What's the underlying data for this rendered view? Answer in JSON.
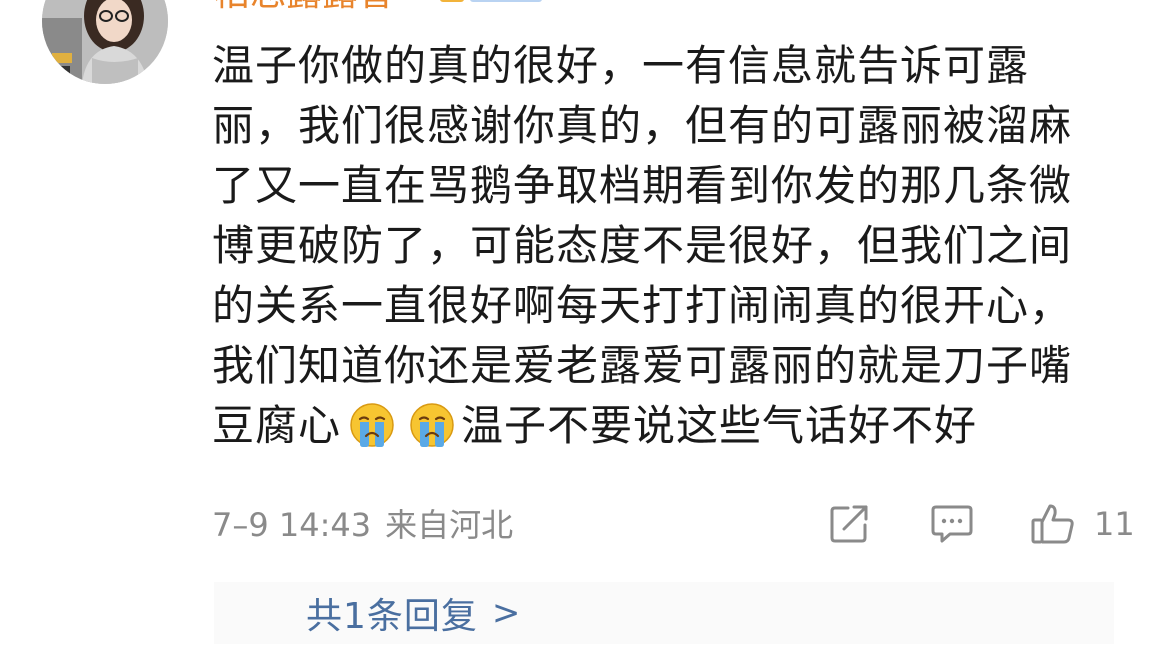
{
  "comment": {
    "author": "柏忘露露香",
    "lines": [
      "温子你做的真的很好，一有信息就告诉可露",
      "丽，我们很感谢你真的，但有的可露丽被溜麻",
      "了又一直在骂鹅争取档期看到你发的那几条微",
      "博更破防了，可能态度不是很好，但我们之间",
      "的关系一直很好啊每天打打闹闹真的很开心，",
      "我们知道你还是爱老露爱可露丽的就是刀子嘴"
    ],
    "last_line_prefix": "豆腐心",
    "last_line_suffix": "温子不要说这些气话好不好",
    "emoji_name": "crying-face-icon",
    "date": "7–9 14:43",
    "location": "来自河北",
    "like_count": "11"
  },
  "replies": {
    "label": "共1条回复",
    "chevron": ">"
  },
  "colors": {
    "text": "#1a1a1a",
    "meta": "#8a8a8a",
    "link": "#4a6fa0",
    "username": "#e8842c"
  }
}
